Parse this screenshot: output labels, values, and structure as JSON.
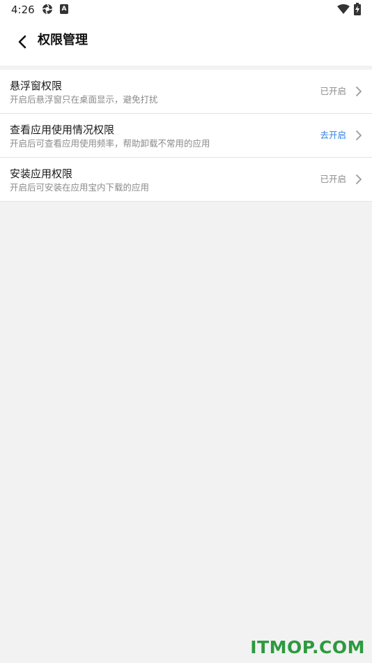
{
  "status_bar": {
    "time": "4:26",
    "notification_icon_b": "A"
  },
  "header": {
    "title": "权限管理"
  },
  "permissions": [
    {
      "title": "悬浮窗权限",
      "description": "开启后悬浮窗只在桌面显示，避免打扰",
      "status": "已开启",
      "status_color": "#8a8a8a"
    },
    {
      "title": "查看应用使用情况权限",
      "description": "开启后可查看应用使用频率，帮助卸载不常用的应用",
      "status": "去开启",
      "status_color": "#2f7fe0"
    },
    {
      "title": "安装应用权限",
      "description": "开启后可安装在应用宝内下载的应用",
      "status": "已开启",
      "status_color": "#8a8a8a"
    }
  ],
  "watermark": "ITMOP.COM",
  "colors": {
    "background": "#f2f2f2",
    "surface": "#ffffff",
    "accent": "#2f7fe0",
    "watermark": "#2d9a3f"
  },
  "icons": {
    "back": "chevron-left-icon",
    "row_arrow": "chevron-right-icon",
    "wifi": "wifi-icon",
    "battery": "battery-charging-icon"
  }
}
